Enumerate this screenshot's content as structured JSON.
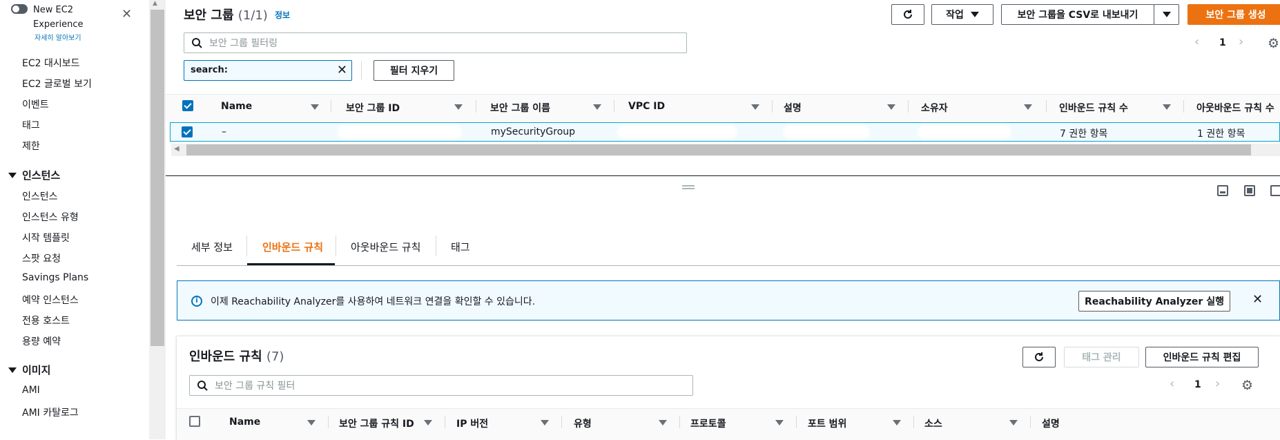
{
  "sidebar": {
    "new_experience": "New EC2 Experience",
    "learn_more": "자세히 알아보기",
    "close": "✕",
    "top_links": [
      "EC2 대시보드",
      "EC2 글로벌 보기",
      "이벤트",
      "태그",
      "제한"
    ],
    "sections": [
      {
        "title": "인스턴스",
        "items": [
          "인스턴스",
          "인스턴스 유형",
          "시작 템플릿",
          "스팟 요청",
          "Savings Plans",
          "예약 인스턴스",
          "전용 호스트",
          "용량 예약"
        ]
      },
      {
        "title": "이미지",
        "items": [
          "AMI",
          "AMI 카탈로그"
        ]
      }
    ]
  },
  "header": {
    "title": "보안 그룹",
    "count": "(1/1)",
    "info": "정보",
    "actions_label": "작업",
    "export_label": "보안 그룹을 CSV로 내보내기",
    "create_label": "보안 그룹 생성",
    "refresh_icon": "refresh-icon"
  },
  "filter": {
    "placeholder": "보안 그룹 필터링",
    "token_label": "search:",
    "clear_label": "필터 지우기",
    "page": "1"
  },
  "table": {
    "columns": [
      "Name",
      "보안 그룹 ID",
      "보안 그룹 이름",
      "VPC ID",
      "설명",
      "소유자",
      "인바운드 규칙 수",
      "아웃바운드 규칙 수"
    ],
    "row": {
      "name": "–",
      "group_name": "mySecurityGroup",
      "inbound": "7 권한 항목",
      "outbound": "1 권한 항목"
    }
  },
  "details": {
    "tabs": [
      "세부 정보",
      "인바운드 규칙",
      "아웃바운드 규칙",
      "태그"
    ],
    "active_tab": "인바운드 규칙",
    "banner_text": "이제 Reachability Analyzer를 사용하여 네트워크 연결을 확인할 수 있습니다.",
    "banner_button": "Reachability Analyzer 실행",
    "rules_title": "인바운드 규칙",
    "rules_count": "(7)",
    "manage_tags": "태그 관리",
    "edit_rules": "인바운드 규칙 편집",
    "rules_filter_placeholder": "보안 그룹 규칙 필터",
    "rules_page": "1",
    "rule_columns": [
      "Name",
      "보안 그룹 규칙 ID",
      "IP 버전",
      "유형",
      "프로토콜",
      "포트 범위",
      "소스",
      "설명"
    ]
  },
  "colors": {
    "accent": "#ec7211",
    "link": "#0073bb",
    "selected_row": "#f1faff"
  }
}
